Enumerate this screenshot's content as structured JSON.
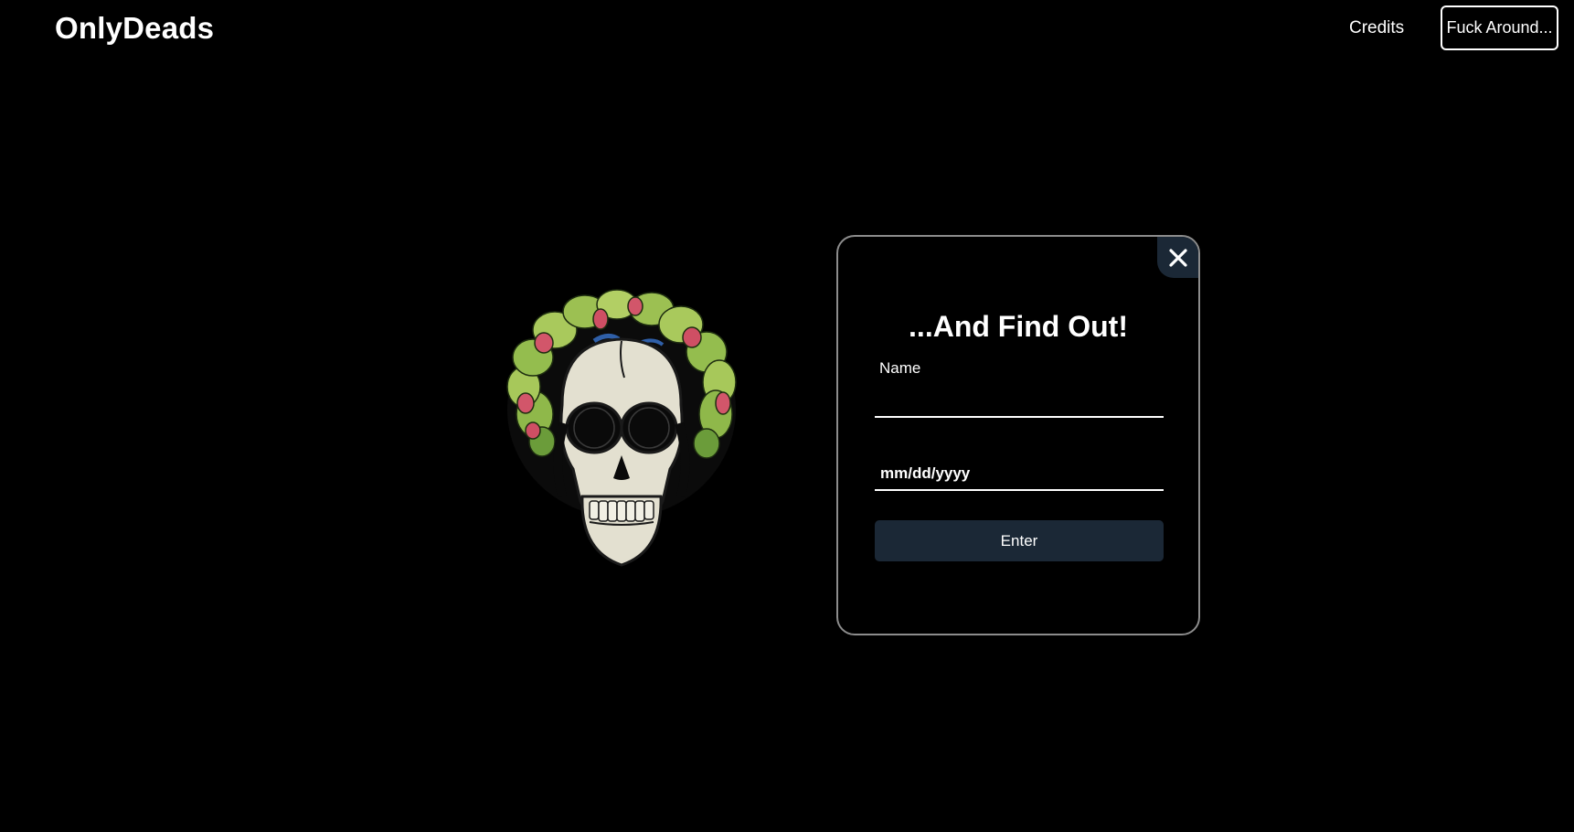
{
  "header": {
    "logo": "OnlyDeads",
    "nav": {
      "credits": "Credits",
      "fuck_around": "Fuck Around..."
    }
  },
  "modal": {
    "title": "...And Find Out!",
    "name_label": "Name",
    "name_value": "",
    "date_placeholder": "mm/dd/yyyy",
    "enter_label": "Enter",
    "close_icon": "close-icon"
  },
  "hero": {
    "image": "skull-with-floral-crown"
  },
  "colors": {
    "background": "#000000",
    "text": "#ffffff",
    "button_bg": "#1b2836",
    "modal_border": "#8c8c8c"
  }
}
